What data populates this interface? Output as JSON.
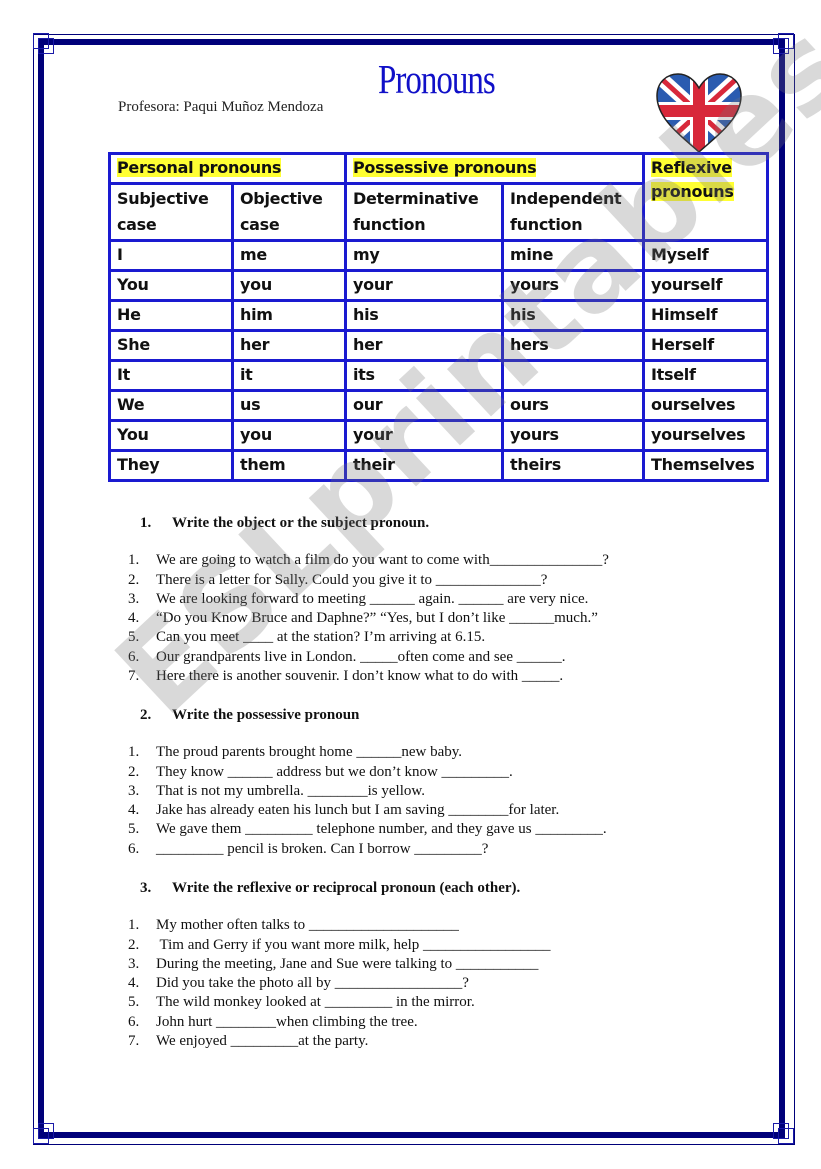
{
  "header": {
    "title": "Pronouns",
    "teacher": "Profesora: Paqui Muñoz Mendoza",
    "logo_icon": "union-jack-heart-icon"
  },
  "table": {
    "group_headers": {
      "personal": "Personal pronouns",
      "possessive": "Possessive pronouns",
      "reflexive_line1": "Reflexive",
      "reflexive_line2": "pronouns"
    },
    "columns": [
      {
        "line1": "Subjective",
        "line2": "case"
      },
      {
        "line1": "Objective",
        "line2": "case"
      },
      {
        "line1": "Determinative",
        "line2": "function"
      },
      {
        "line1": "Independent",
        "line2": "function"
      }
    ],
    "rows": [
      {
        "subjective": "I",
        "objective": "me",
        "determinative": "my",
        "independent": "mine",
        "reflexive": "Myself"
      },
      {
        "subjective": "You",
        "objective": "you",
        "determinative": "your",
        "independent": "yours",
        "reflexive": "yourself"
      },
      {
        "subjective": "He",
        "objective": "him",
        "determinative": "his",
        "independent": "his",
        "reflexive": "Himself"
      },
      {
        "subjective": "She",
        "objective": "her",
        "determinative": "her",
        "independent": "hers",
        "reflexive": "Herself"
      },
      {
        "subjective": "It",
        "objective": "it",
        "determinative": "its",
        "independent": "",
        "reflexive": "Itself"
      },
      {
        "subjective": "We",
        "objective": "us",
        "determinative": "our",
        "independent": "ours",
        "reflexive": "ourselves"
      },
      {
        "subjective": "You",
        "objective": "you",
        "determinative": "your",
        "independent": "yours",
        "reflexive": "yourselves"
      },
      {
        "subjective": "They",
        "objective": "them",
        "determinative": "their",
        "independent": "theirs",
        "reflexive": "Themselves"
      }
    ]
  },
  "exercises": [
    {
      "number": "1.",
      "title": "Write the object or the subject pronoun.",
      "items": [
        {
          "n": "1.",
          "text": "We are going to watch a film do you want to come with_______________?"
        },
        {
          "n": "2.",
          "text": "There is a letter for Sally. Could you give it to ______________?"
        },
        {
          "n": "3.",
          "text": "We are looking forward to meeting ______ again. ______ are very nice."
        },
        {
          "n": "4.",
          "text": "“Do you Know Bruce and Daphne?” “Yes, but I don’t like ______much.”"
        },
        {
          "n": "5.",
          "text": "Can you meet ____ at the station? I’m arriving at 6.15."
        },
        {
          "n": "6.",
          "text": "Our grandparents live in London. _____often come and see ______."
        },
        {
          "n": "7.",
          "text": "Here there is another souvenir. I don’t know what to do with _____."
        }
      ]
    },
    {
      "number": "2.",
      "title": "Write the possessive pronoun",
      "items": [
        {
          "n": "1.",
          "text": "The proud parents brought home ______new baby."
        },
        {
          "n": "2.",
          "text": "They know ______ address but we don’t know _________."
        },
        {
          "n": "3.",
          "text": "That is not my umbrella. ________is yellow."
        },
        {
          "n": "4.",
          "text": "Jake has already eaten his lunch but I am saving ________for later."
        },
        {
          "n": "5.",
          "text": "We gave them _________ telephone number, and they gave us _________."
        },
        {
          "n": "6.",
          "text": "_________ pencil is broken. Can I borrow _________?"
        }
      ]
    },
    {
      "number": "3.",
      "title": "Write the reflexive or reciprocal pronoun (each other).",
      "items": [
        {
          "n": "1.",
          "text": "My mother often talks to ____________________"
        },
        {
          "n": "2.",
          "text": " Tim and Gerry if you want more milk, help _________________"
        },
        {
          "n": "3.",
          "text": "During the meeting, Jane and Sue were talking to ___________"
        },
        {
          "n": "4.",
          "text": "Did you take the photo all by _________________?"
        },
        {
          "n": "5.",
          "text": "The wild monkey looked at _________ in the mirror."
        },
        {
          "n": "6.",
          "text": "John hurt ________when climbing the tree."
        },
        {
          "n": "7.",
          "text": "We enjoyed _________at the party."
        }
      ]
    }
  ],
  "watermark": "ESLprintables.com",
  "colors": {
    "frame": "#00007a",
    "table_border": "#1a1ad0",
    "highlight": "#ffff33",
    "title": "#1010c8"
  }
}
